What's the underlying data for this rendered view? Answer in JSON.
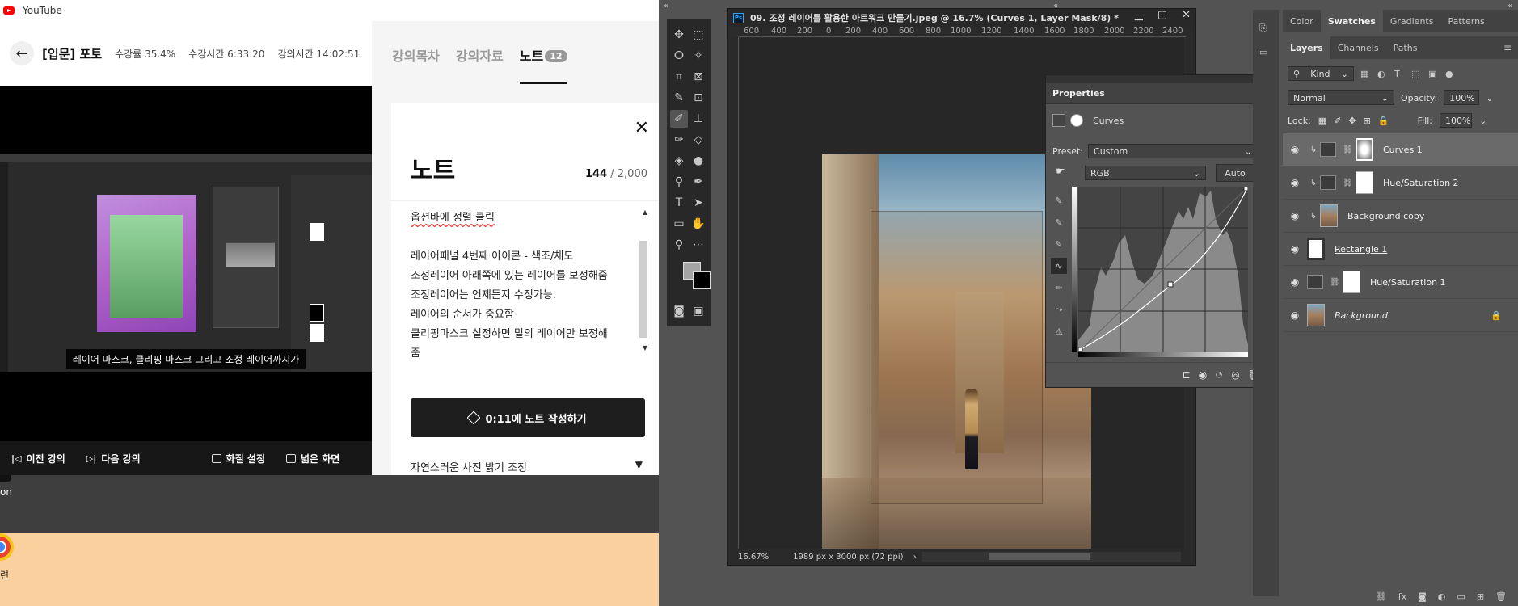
{
  "browser": {
    "tab_title": "YouTube",
    "lecture_title": "[입문] 포토",
    "stats": [
      "수강률 35.4%",
      "수강시간 6:33:20",
      "강의시간 14:02:51"
    ],
    "caption": "레이어 마스크, 클리핑 마스크 그리고 조정 레이어까지가",
    "controls": [
      "이전 강의",
      "다음 강의",
      "화질 설정",
      "넓은 화면"
    ],
    "tabs": [
      {
        "label": "강의목차"
      },
      {
        "label": "강의자료"
      },
      {
        "label": "노트",
        "count": "12"
      }
    ],
    "note": {
      "title": "노트",
      "count_current": "144",
      "count_max": " / 2,000",
      "lines": [
        "옵션바에 정렬 클릭",
        "",
        "레이어패널 4번째 아이콘 - 색조/채도",
        "조정레이어 아래쪽에 있는 레이어를 보정해줌",
        "조정레이어는 언제든지 수정가능.",
        "레이어의 순서가 중요함",
        "클리핑마스크 설정하면 밑의 레이어만 보정해",
        "줌"
      ],
      "write_button": "0:11에 노트 작성하기",
      "next_note": "자연스러운 사진 밝기 조정"
    },
    "desktop_text": "on",
    "desktop_icon_label": "련"
  },
  "photoshop": {
    "doc_title": "09. 조정 레이어를 활용한 아트워크 만들기.jpeg @ 16.7% (Curves 1, Layer Mask/8) *",
    "ps_tag": "Ps",
    "ruler_labels": [
      "600",
      "400",
      "200",
      "0",
      "200",
      "400",
      "600",
      "800",
      "1000",
      "1200",
      "1400",
      "1600",
      "1800",
      "2000",
      "2200",
      "2400"
    ],
    "zoom": "16.67%",
    "doc_size": "1989 px x 3000 px (72 ppi)",
    "properties": {
      "title": "Properties",
      "type": "Curves",
      "preset_label": "Preset:",
      "preset_value": "Custom",
      "channel": "RGB",
      "auto": "Auto"
    },
    "panel_tabs_top": [
      "Color",
      "Swatches",
      "Gradients",
      "Patterns"
    ],
    "panel_tabs_layers": [
      "Layers",
      "Channels",
      "Paths"
    ],
    "filter_kind": "Kind",
    "blend_mode": "Normal",
    "opacity_label": "Opacity:",
    "opacity_value": "100%",
    "lock_label": "Lock:",
    "fill_label": "Fill:",
    "fill_value": "100%",
    "layers": [
      {
        "name": "Curves 1",
        "type": "curves",
        "clip": true,
        "selected": true
      },
      {
        "name": "Hue/Saturation 2",
        "type": "hue",
        "clip": true
      },
      {
        "name": "Background copy",
        "type": "photo",
        "clip": true
      },
      {
        "name": "Rectangle 1",
        "type": "rect",
        "underline": true
      },
      {
        "name": "Hue/Saturation 1",
        "type": "hue"
      },
      {
        "name": "Background",
        "type": "bg",
        "italic": true,
        "locked": true
      }
    ],
    "tool_icons": [
      "move-icon",
      "marquee-icon",
      "lasso-icon",
      "magic-wand-icon",
      "crop-icon",
      "frame-icon",
      "eyedropper-icon",
      "patch-icon",
      "brush-icon",
      "stamp-icon",
      "history-brush-icon",
      "eraser-icon",
      "bucket-icon",
      "drop-icon",
      "dodge-icon",
      "pen-icon",
      "type-icon",
      "path-select-icon",
      "shape-icon",
      "hand-icon",
      "zoom-icon",
      "more-icon"
    ]
  },
  "colors": {
    "ps_bg": "#535353",
    "ps_dark": "#282828",
    "note_button": "#1e1e1e",
    "peach": "#fbd09f"
  }
}
